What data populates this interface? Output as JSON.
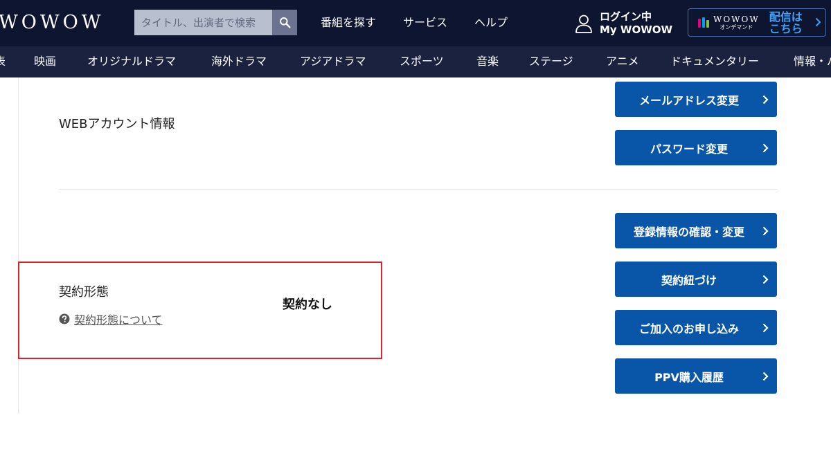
{
  "header": {
    "logo": "WOWOW",
    "search": {
      "placeholder": "タイトル、出演者で検索",
      "value": ""
    },
    "nav": [
      "番組を探す",
      "サービス",
      "ヘルプ"
    ],
    "login": {
      "line1": "ログイン中",
      "line2": "My WOWOW"
    },
    "ondemand": {
      "brand": "WOWOW",
      "brand_sub": "オンデマンド",
      "cta_line1": "配信は",
      "cta_line2": "こちら"
    }
  },
  "categories": [
    "表",
    "映画",
    "オリジナルドラマ",
    "海外ドラマ",
    "アジアドラマ",
    "スポーツ",
    "音楽",
    "ステージ",
    "アニメ",
    "ドキュメンタリー",
    "情報・バ"
  ],
  "web_account": {
    "label": "WEBアカウント情報",
    "buttons": [
      "メールアドレス変更",
      "パスワード変更"
    ]
  },
  "contract": {
    "label": "契約形態",
    "help_link": "契約形態について",
    "value": "契約なし",
    "buttons": [
      "登録情報の確認・変更",
      "契約紐づけ",
      "ご加入のお申し込み",
      "PPV購入履歴"
    ]
  },
  "colors": {
    "header_bg": "#0e1530",
    "category_bg": "#1b2240",
    "button_bg": "#0956a8",
    "highlight": "#d9242f",
    "ondemand_cta": "#3fa2f7"
  },
  "icons": [
    "search-icon",
    "user-icon",
    "chevron-right-icon",
    "question-circle-icon",
    "wowow-od-mark-icon"
  ]
}
